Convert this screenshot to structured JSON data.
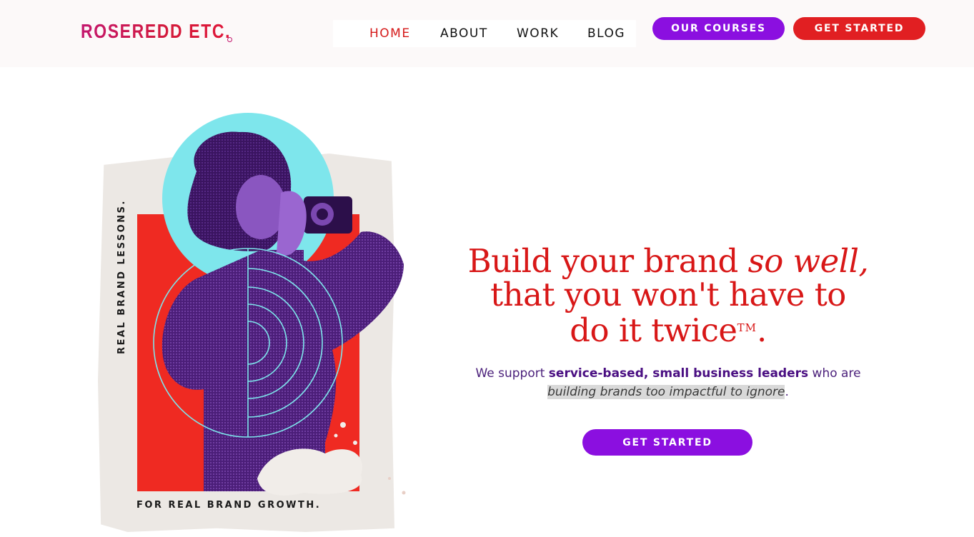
{
  "header": {
    "logo_text": "ROSEREDD ETC.",
    "nav": [
      {
        "label": "HOME",
        "active": true
      },
      {
        "label": "ABOUT",
        "active": false
      },
      {
        "label": "WORK",
        "active": false
      },
      {
        "label": "BLOG",
        "active": false
      }
    ],
    "courses_button": "OUR COURSES",
    "get_started_button": "GET STARTED"
  },
  "collage": {
    "side_text": "REAL BRAND LESSONS.",
    "bottom_text": "FOR REAL BRAND GROWTH."
  },
  "hero": {
    "headline_part1": "Build your brand ",
    "headline_italic": "so well,",
    "headline_part2": "that you won't have to",
    "headline_part3": "do it twice",
    "headline_tm": "TM",
    "headline_end": ".",
    "sub_part1": "We support ",
    "sub_bold": "service-based, small business leaders",
    "sub_part2": " who are",
    "sub_highlight": "building brands too impactful to ignore",
    "sub_end": ".",
    "cta_label": "GET STARTED"
  },
  "colors": {
    "brand_red": "#e11f22",
    "brand_purple": "#8b0fe0",
    "headline_red": "#d81717",
    "teal": "#7ee6ec"
  }
}
